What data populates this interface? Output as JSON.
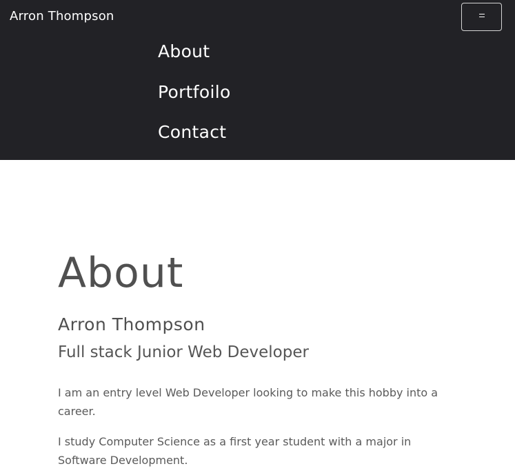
{
  "navbar": {
    "brand": "Arron Thompson",
    "toggler_icon": "hamburger-icon",
    "links": [
      {
        "label": "About"
      },
      {
        "label": "Portfoilo"
      },
      {
        "label": "Contact"
      }
    ],
    "background": "#222226"
  },
  "about": {
    "title": "About",
    "name": "Arron Thompson",
    "role": "Full stack Junior Web Developer",
    "paragraphs": [
      "I am an entry level Web Developer looking to make this hobby into a career.",
      "I study Computer Science as a first year student with a major in Software Development."
    ]
  }
}
